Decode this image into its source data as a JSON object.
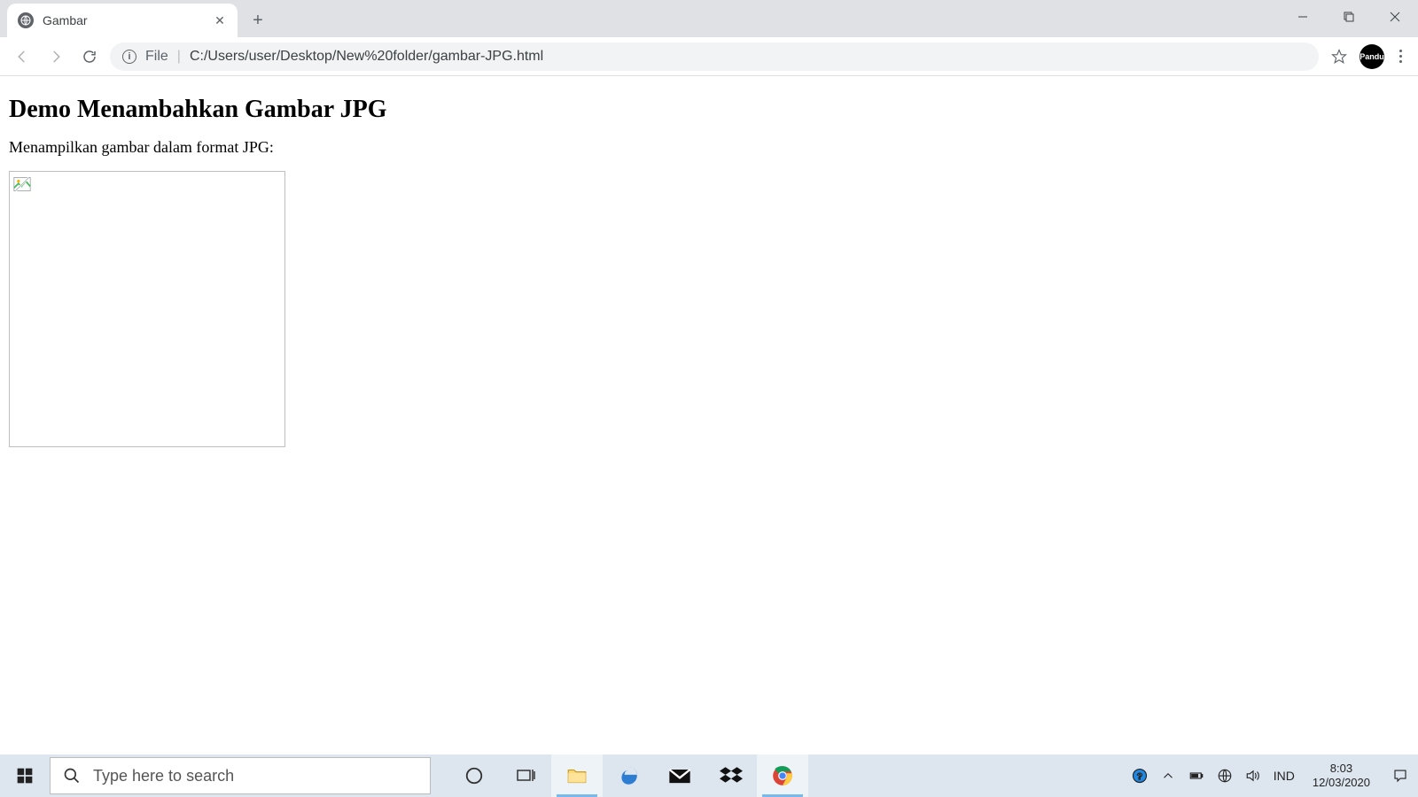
{
  "browser": {
    "tab_title": "Gambar",
    "url_label": "File",
    "url_path": "C:/Users/user/Desktop/New%20folder/gambar-JPG.html",
    "avatar_text": "Pandu"
  },
  "page": {
    "heading": "Demo Menambahkan Gambar JPG",
    "paragraph": "Menampilkan gambar dalam format JPG:"
  },
  "taskbar": {
    "search_placeholder": "Type here to search",
    "language": "IND",
    "time": "8:03",
    "date": "12/03/2020"
  }
}
